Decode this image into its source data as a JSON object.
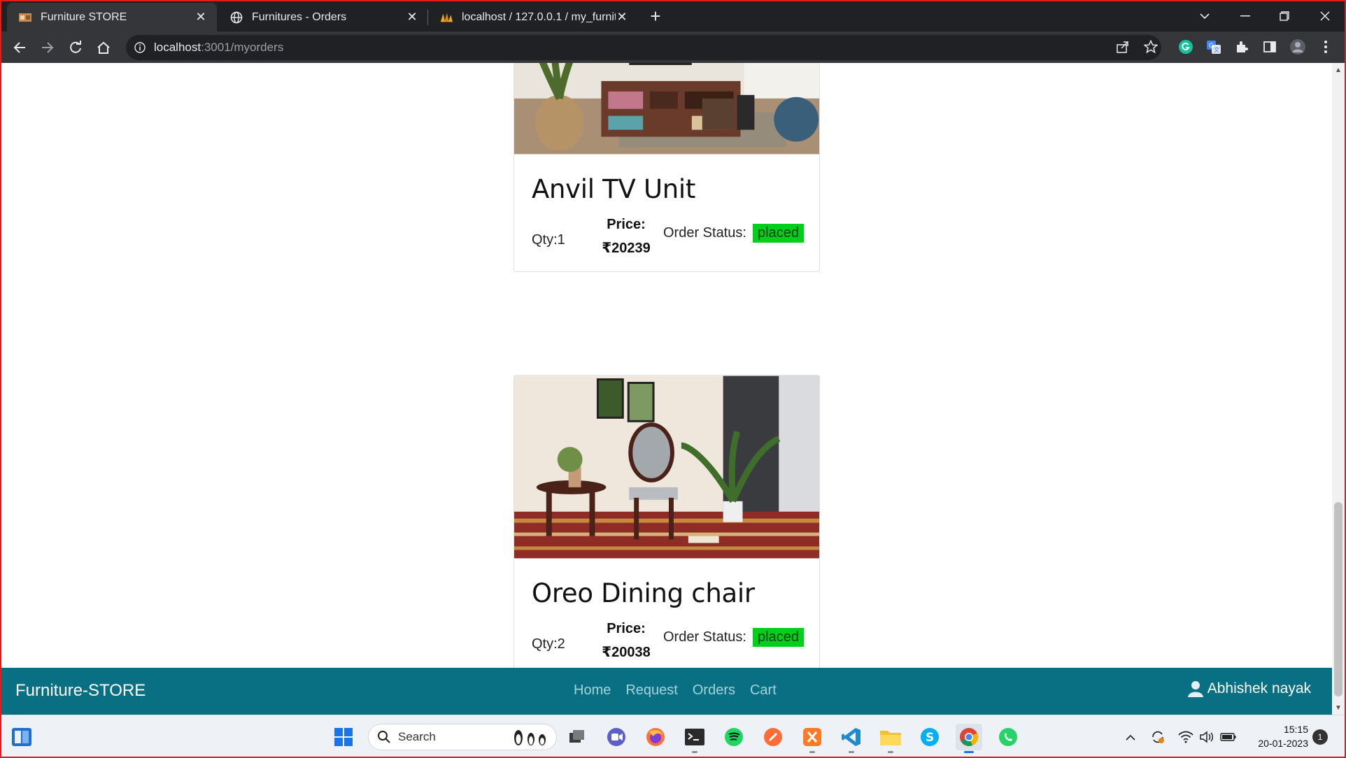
{
  "browser": {
    "tabs": [
      {
        "title": "Furniture STORE",
        "active": true,
        "icon": "store-favicon"
      },
      {
        "title": "Furnitures - Orders",
        "active": false,
        "icon": "globe-icon"
      },
      {
        "title": "localhost / 127.0.0.1 / my_furnitu",
        "active": false,
        "icon": "phpmyadmin-icon"
      }
    ],
    "url_host": "localhost",
    "url_path": ":3001/myorders"
  },
  "orders": [
    {
      "name": "Anvil TV Unit",
      "qty": "Qty:1",
      "price_label": "Price:",
      "price": "₹20239",
      "status_label": "Order Status:",
      "status": "placed",
      "image": "tv-unit-photo"
    },
    {
      "name": "Oreo Dining chair",
      "qty": "Qty:2",
      "price_label": "Price:",
      "price": "₹20038",
      "status_label": "Order Status:",
      "status": "placed",
      "image": "dining-chair-photo"
    }
  ],
  "appbar": {
    "brand": "Furniture-STORE",
    "links": [
      "Home",
      "Request",
      "Orders",
      "Cart"
    ],
    "user": "Abhishek nayak",
    "color": "#097083"
  },
  "taskbar": {
    "search_placeholder": "Search",
    "time": "15:15",
    "date": "20-01-2023",
    "notifications": "1"
  },
  "colors": {
    "status_placed": "#00d01b",
    "frame": "#e21b1b"
  }
}
